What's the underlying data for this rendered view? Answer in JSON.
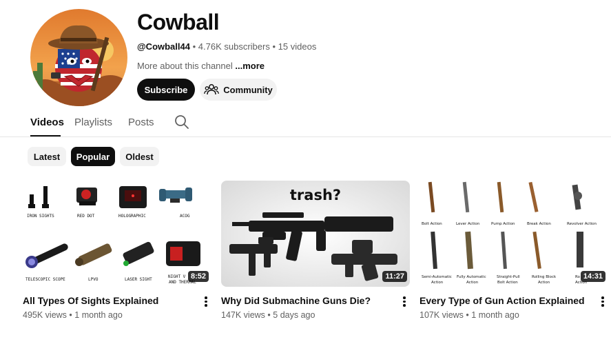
{
  "channel": {
    "name": "Cowball",
    "handle": "@Cowball44",
    "subscribers": "4.76K subscribers",
    "videos_count": "15 videos",
    "separator": "•",
    "about": "More about this channel",
    "more_label": "...more",
    "subscribe_label": "Subscribe",
    "community_label": "Community"
  },
  "tabs": [
    {
      "label": "Videos"
    },
    {
      "label": "Playlists"
    },
    {
      "label": "Posts"
    }
  ],
  "chips": [
    {
      "label": "Latest"
    },
    {
      "label": "Popular"
    },
    {
      "label": "Oldest"
    }
  ],
  "videos": [
    {
      "title": "All Types Of Sights Explained",
      "views": "495K views",
      "age": "1 month ago",
      "duration": "8:52",
      "thumb_labels": [
        "IRON SIGHTS",
        "RED DOT",
        "HOLOGRAPHIC",
        "ACOG",
        "TELESCOPIC SCOPE",
        "LPVO",
        "LASER SIGHT",
        "NIGHT V",
        "AND THERMAL"
      ]
    },
    {
      "title": "Why Did Submachine Guns Die?",
      "views": "147K views",
      "age": "5 days ago",
      "duration": "11:27",
      "thumb_text": "trash?"
    },
    {
      "title": "Every Type of Gun Action Explained",
      "views": "107K views",
      "age": "1 month ago",
      "duration": "14:31",
      "thumb_labels": [
        "Bolt Action",
        "Lever Action",
        "Pump Action",
        "Break Action",
        "Revolver Action",
        "Semi-Automatic",
        "Action",
        "Fully Automatic",
        "Action",
        "Straight-Pull",
        "Bolt Action",
        "Rolling Block",
        "Action",
        "Ro",
        "Action"
      ]
    }
  ],
  "colors": {
    "text": "#0f0f0f",
    "secondary": "#606060",
    "chip_bg": "#f2f2f2",
    "divider": "#e5e5e5"
  },
  "icons": [
    "community-icon",
    "search-icon",
    "more-vert-icon"
  ]
}
